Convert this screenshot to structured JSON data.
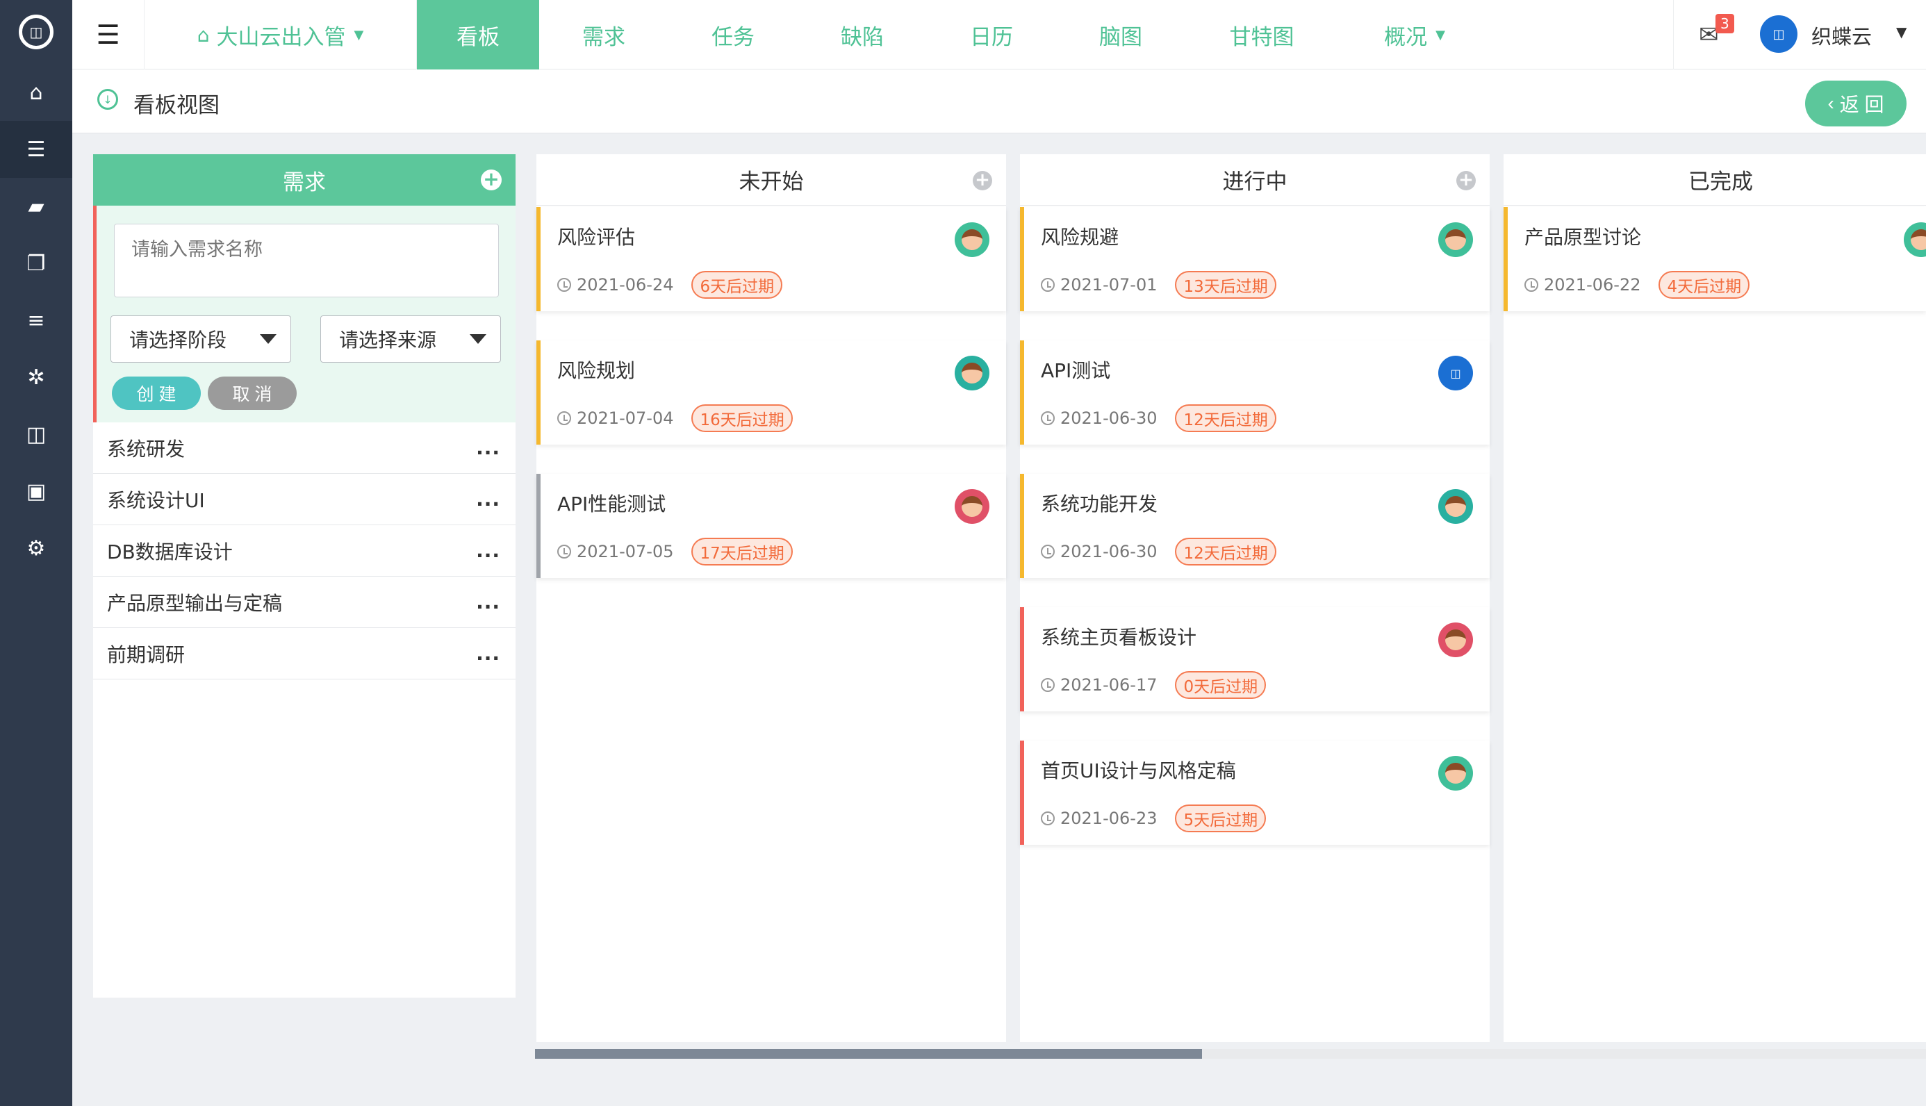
{
  "app": {
    "logo_text": "",
    "rail_icons": [
      "home-icon",
      "list-icon",
      "folder-icon",
      "files-icon",
      "server-icon",
      "bug-icon",
      "columns-icon",
      "vimeo-icon",
      "settings-icon"
    ]
  },
  "topbar": {
    "project": "大山云出入管",
    "nav": [
      {
        "label": "看板",
        "active": true
      },
      {
        "label": "需求"
      },
      {
        "label": "任务"
      },
      {
        "label": "缺陷"
      },
      {
        "label": "日历"
      },
      {
        "label": "脑图"
      },
      {
        "label": "甘特图"
      },
      {
        "label": "概况"
      }
    ],
    "mail_count": "3",
    "user_name": "织蝶云"
  },
  "subheader": {
    "title": "看板视图",
    "back_label": "返 回"
  },
  "requirements": {
    "title": "需求",
    "form": {
      "name_placeholder": "请输入需求名称",
      "stage_select": "请选择阶段",
      "source_select": "请选择来源",
      "create_label": "创 建",
      "cancel_label": "取 消"
    },
    "items": [
      "系统研发",
      "系统设计UI",
      "DB数据库设计",
      "产品原型输出与定稿",
      "前期调研"
    ],
    "more_label": "..."
  },
  "columns": [
    {
      "title": "未开始",
      "cards": [
        {
          "title": "风险评估",
          "date": "2021-06-24",
          "due": "6天后过期",
          "color": "#f5b82e",
          "avatar": "green"
        },
        {
          "title": "风险规划",
          "date": "2021-07-04",
          "due": "16天后过期",
          "color": "#f5b82e",
          "avatar": "teal"
        },
        {
          "title": "API性能测试",
          "date": "2021-07-05",
          "due": "17天后过期",
          "color": "#a0a4aa",
          "avatar": "red"
        }
      ]
    },
    {
      "title": "进行中",
      "cards": [
        {
          "title": "风险规避",
          "date": "2021-07-01",
          "due": "13天后过期",
          "color": "#f5b82e",
          "avatar": "green"
        },
        {
          "title": "API测试",
          "date": "2021-06-30",
          "due": "12天后过期",
          "color": "#f5b82e",
          "avatar": "blue"
        },
        {
          "title": "系统功能开发",
          "date": "2021-06-30",
          "due": "12天后过期",
          "color": "#f5b82e",
          "avatar": "teal"
        },
        {
          "title": "系统主页看板设计",
          "date": "2021-06-17",
          "due": "0天后过期",
          "color": "#f1625a",
          "avatar": "red"
        },
        {
          "title": "首页UI设计与风格定稿",
          "date": "2021-06-23",
          "due": "5天后过期",
          "color": "#f1625a",
          "avatar": "green"
        }
      ]
    },
    {
      "title": "已完成",
      "cards": [
        {
          "title": "产品原型讨论",
          "date": "2021-06-22",
          "due": "4天后过期",
          "color": "#f5b82e",
          "avatar": "green"
        }
      ]
    }
  ],
  "colors": {
    "accent": "#5cc79b",
    "rail": "#2f3a4c",
    "danger": "#f1625a",
    "warning": "#f5b82e"
  }
}
